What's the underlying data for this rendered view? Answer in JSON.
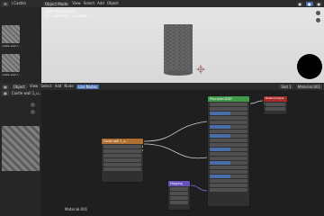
{
  "top_left": {
    "menu1": "☰",
    "file1": "\\.Castle\\",
    "up_label": "↑"
  },
  "viewport": {
    "mode": "Object Mode",
    "menus": [
      "View",
      "Select",
      "Add",
      "Object"
    ],
    "info_line1": "User Perspective",
    "info_line2": "(1) Collection | Cylinder",
    "sphere_color": "#000000"
  },
  "file_browser": {
    "items": [
      "castle wall t...",
      "castle wall t..."
    ],
    "image_name": "Castle wall 1_u..."
  },
  "node_editor": {
    "editor_menu": "Object",
    "menus": [
      "View",
      "Select",
      "Add",
      "Node"
    ],
    "use_nodes": "Use Nodes",
    "slot": "Slot 1",
    "material": "Material.001",
    "footer_label": "Material.001"
  },
  "nodes": {
    "image_texture": {
      "title": "Castle wall 1_u...",
      "color": "#b06f2e"
    },
    "principled": {
      "title": "Principled BSDF",
      "color": "#3f9b4a"
    },
    "output": {
      "title": "Material Output",
      "color": "#a92c2c"
    },
    "mapping": {
      "title": "Mapping",
      "color": "#6a4fbf"
    }
  },
  "icons": [
    "hand-icon",
    "magnify-icon",
    "camera-icon",
    "render-icon"
  ]
}
